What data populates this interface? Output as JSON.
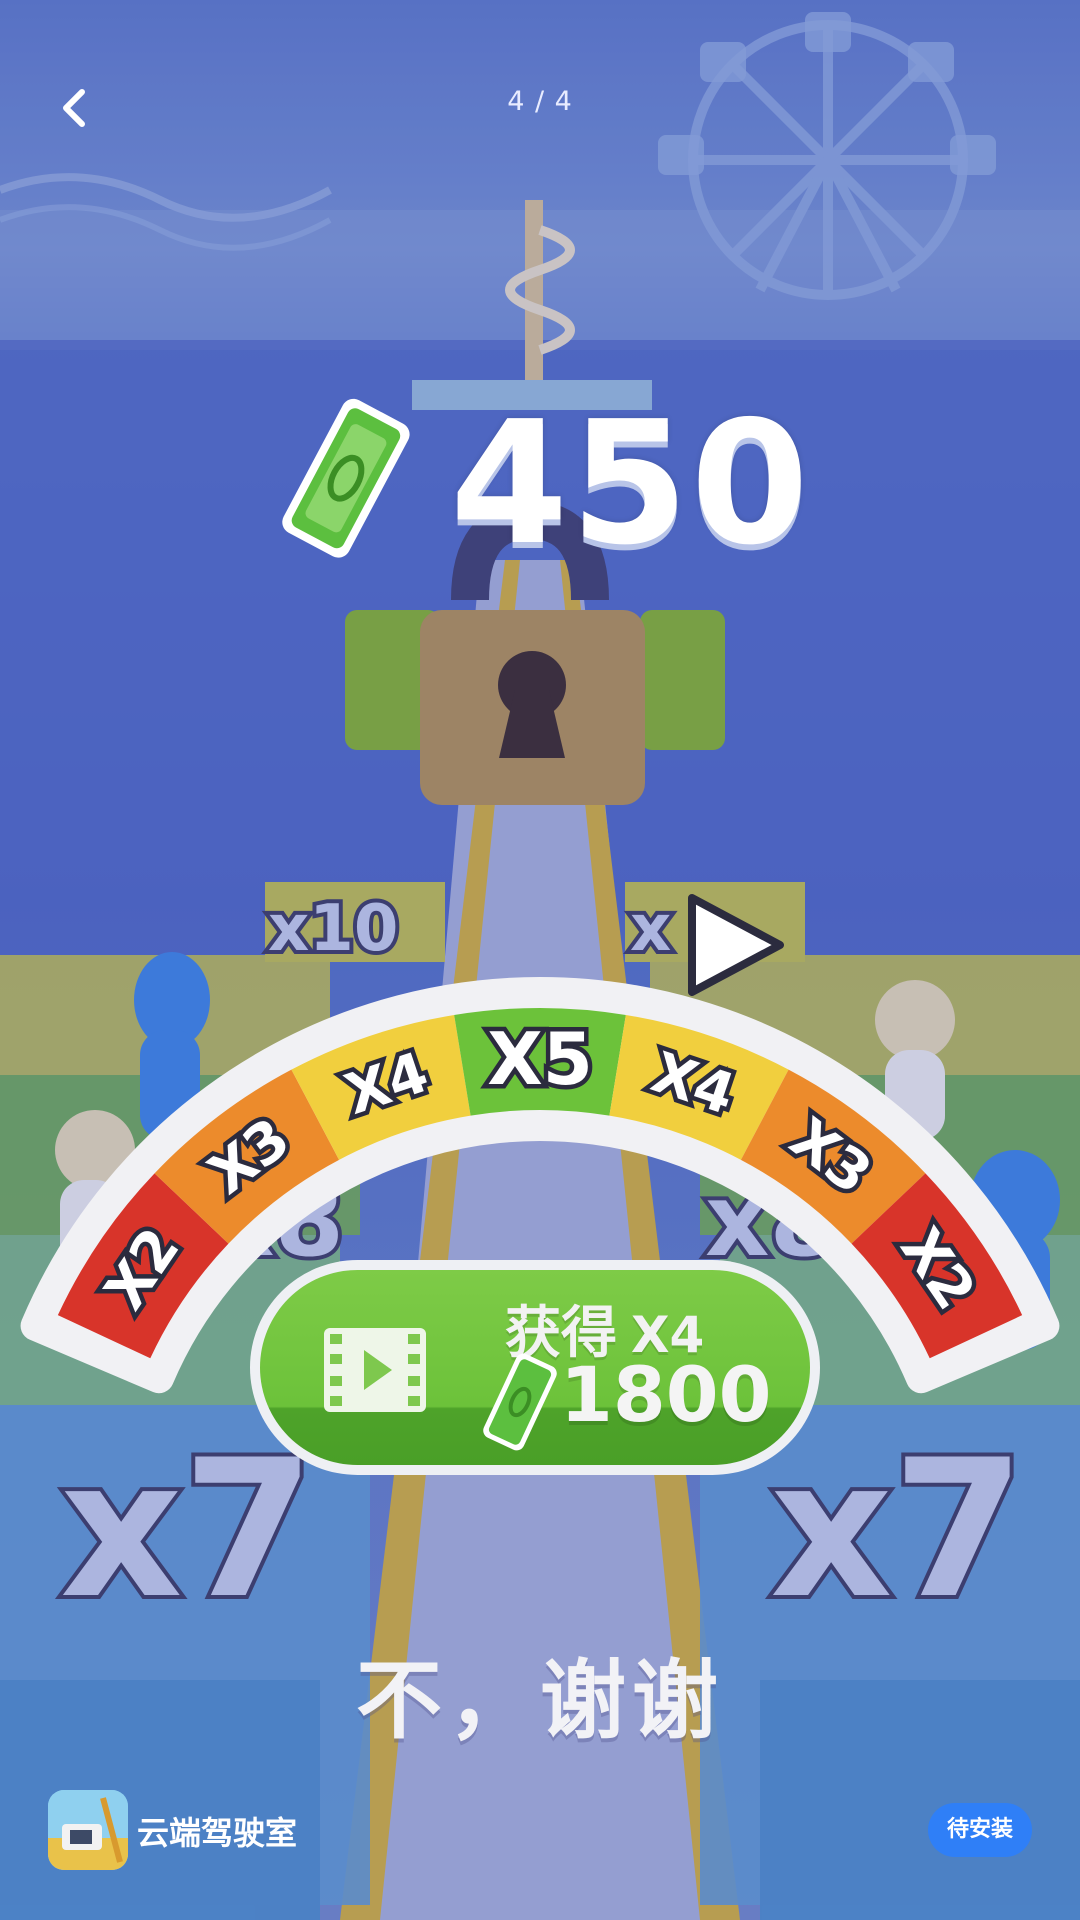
{
  "topbar": {
    "page_indicator": "4 / 4"
  },
  "score": {
    "amount": "450"
  },
  "multiplier_meter": {
    "segments": [
      {
        "label": "X2",
        "color": "#d8342a"
      },
      {
        "label": "X3",
        "color": "#ec8b2c"
      },
      {
        "label": "X4",
        "color": "#f1cf3e"
      },
      {
        "label": "X5",
        "color": "#6cc23a"
      },
      {
        "label": "X4",
        "color": "#f1cf3e"
      },
      {
        "label": "X3",
        "color": "#ec8b2c"
      },
      {
        "label": "X2",
        "color": "#d8342a"
      }
    ]
  },
  "floor_tiles": {
    "top_left": "x10",
    "top_right": "x",
    "left_mid": "x8",
    "right_mid": "x8",
    "bottom_left": "x7",
    "bottom_right": "x7"
  },
  "claim_button": {
    "label": "获得",
    "multiplier": "X4",
    "reward": "1800"
  },
  "no_thanks": "不，谢谢",
  "footer": {
    "app_name": "云端驾驶室",
    "install_label": "待安装"
  },
  "colors": {
    "accent": "#2f7ff7",
    "button_green": "#6cc23a",
    "sky": "#5a74c8"
  }
}
